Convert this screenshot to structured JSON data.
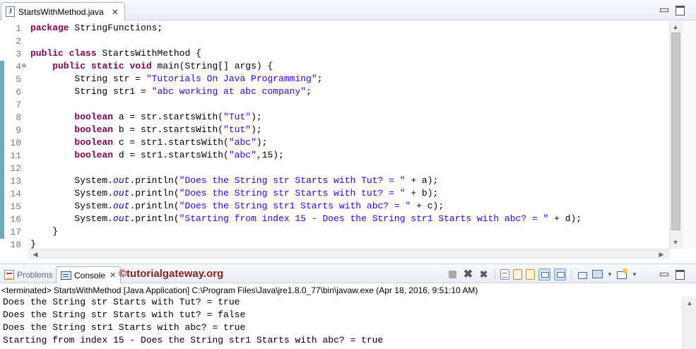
{
  "editor": {
    "tab": {
      "icon": "java-file-icon",
      "icon_glyph": "J",
      "label": "StartsWithMethod.java",
      "close_glyph": "✕"
    },
    "line_numbers": [
      "1",
      "2",
      "3",
      "4",
      "5",
      "6",
      "7",
      "8",
      "9",
      "10",
      "11",
      "12",
      "13",
      "14",
      "15",
      "16",
      "17",
      "18"
    ],
    "fold_marker": "⊖",
    "code": [
      [
        {
          "t": "package",
          "c": "kw"
        },
        {
          "t": " StringFunctions;"
        }
      ],
      [],
      [
        {
          "t": "public",
          "c": "kw"
        },
        {
          "t": " "
        },
        {
          "t": "class",
          "c": "kw"
        },
        {
          "t": " StartsWithMethod {"
        }
      ],
      [
        {
          "t": "    "
        },
        {
          "t": "public",
          "c": "kw"
        },
        {
          "t": " "
        },
        {
          "t": "static",
          "c": "kw"
        },
        {
          "t": " "
        },
        {
          "t": "void",
          "c": "kw"
        },
        {
          "t": " main(String[] args) {"
        }
      ],
      [
        {
          "t": "        String str = "
        },
        {
          "t": "\"Tutorials On Java Programming\"",
          "c": "str"
        },
        {
          "t": ";"
        }
      ],
      [
        {
          "t": "        String str1 = "
        },
        {
          "t": "\"abc working at abc company\"",
          "c": "str"
        },
        {
          "t": ";"
        }
      ],
      [],
      [
        {
          "t": "        "
        },
        {
          "t": "boolean",
          "c": "kw"
        },
        {
          "t": " a = str.startsWith("
        },
        {
          "t": "\"Tut\"",
          "c": "str"
        },
        {
          "t": ");"
        }
      ],
      [
        {
          "t": "        "
        },
        {
          "t": "boolean",
          "c": "kw"
        },
        {
          "t": " b = str.startsWith("
        },
        {
          "t": "\"tut\"",
          "c": "str"
        },
        {
          "t": ");"
        }
      ],
      [
        {
          "t": "        "
        },
        {
          "t": "boolean",
          "c": "kw"
        },
        {
          "t": " c = str1.startsWith("
        },
        {
          "t": "\"abc\"",
          "c": "str"
        },
        {
          "t": ");"
        }
      ],
      [
        {
          "t": "        "
        },
        {
          "t": "boolean",
          "c": "kw"
        },
        {
          "t": " d = str1.startsWith("
        },
        {
          "t": "\"abc\"",
          "c": "str"
        },
        {
          "t": ",15);"
        }
      ],
      [],
      [
        {
          "t": "        System."
        },
        {
          "t": "out",
          "c": "fld"
        },
        {
          "t": ".println("
        },
        {
          "t": "\"Does the String str Starts with Tut? = \"",
          "c": "str"
        },
        {
          "t": " + a);"
        }
      ],
      [
        {
          "t": "        System."
        },
        {
          "t": "out",
          "c": "fld"
        },
        {
          "t": ".println("
        },
        {
          "t": "\"Does the String str Starts with tut? = \"",
          "c": "str"
        },
        {
          "t": " + b);"
        }
      ],
      [
        {
          "t": "        System."
        },
        {
          "t": "out",
          "c": "fld"
        },
        {
          "t": ".println("
        },
        {
          "t": "\"Does the String str1 Starts with abc? = \"",
          "c": "str"
        },
        {
          "t": " + c);"
        }
      ],
      [
        {
          "t": "        System."
        },
        {
          "t": "out",
          "c": "fld"
        },
        {
          "t": ".println("
        },
        {
          "t": "\"Starting from index 15 - Does the String str1 Starts with abc? = \"",
          "c": "str"
        },
        {
          "t": " + d);"
        }
      ],
      [
        {
          "t": "    }"
        }
      ],
      [
        {
          "t": "}"
        }
      ]
    ],
    "change_bar_color": "#6ea9b5",
    "scroll": {
      "up_arrow": "▲",
      "down_arrow": "▼",
      "left_arrow": "◀",
      "right_arrow": "▶"
    }
  },
  "console_view": {
    "problems_tab": {
      "icon": "problems-icon",
      "label": "Problems"
    },
    "console_tab": {
      "icon": "console-icon",
      "label": "Console",
      "close_glyph": "✕"
    },
    "brand": "©tutorialgateway.org",
    "toolbar_buttons": [
      {
        "name": "terminate-button",
        "icon": "stop-icon"
      },
      {
        "name": "remove-launch-button",
        "icon": "remove-icon",
        "glyph": "✖"
      },
      {
        "name": "remove-all-terminated-button",
        "icon": "remove-all-icon",
        "glyph": "✖"
      },
      {
        "name": "clear-console-button",
        "icon": "clear-console-icon"
      },
      {
        "name": "scroll-lock-button",
        "icon": "scroll-lock-icon"
      },
      {
        "name": "word-wrap-button",
        "icon": "word-wrap-icon"
      },
      {
        "name": "show-console-on-stdout-button",
        "icon": "show-stdout-icon"
      },
      {
        "name": "show-console-on-stderr-button",
        "icon": "show-stderr-icon"
      },
      {
        "name": "pin-console-button",
        "icon": "pin-icon"
      },
      {
        "name": "display-selected-console-button",
        "icon": "monitor-icon"
      },
      {
        "name": "open-console-button",
        "icon": "new-console-icon"
      }
    ],
    "terminated_text": "<terminated> StartsWithMethod [Java Application] C:\\Program Files\\Java\\jre1.8.0_77\\bin\\javaw.exe (Apr 18, 2016, 9:51:10 AM)",
    "output_lines": [
      "Does the String str Starts with Tut? = true",
      "Does the String str Starts with tut? = false",
      "Does the String str1 Starts with abc? = true",
      "Starting from index 15 - Does the String str1 Starts with abc? = true"
    ]
  }
}
